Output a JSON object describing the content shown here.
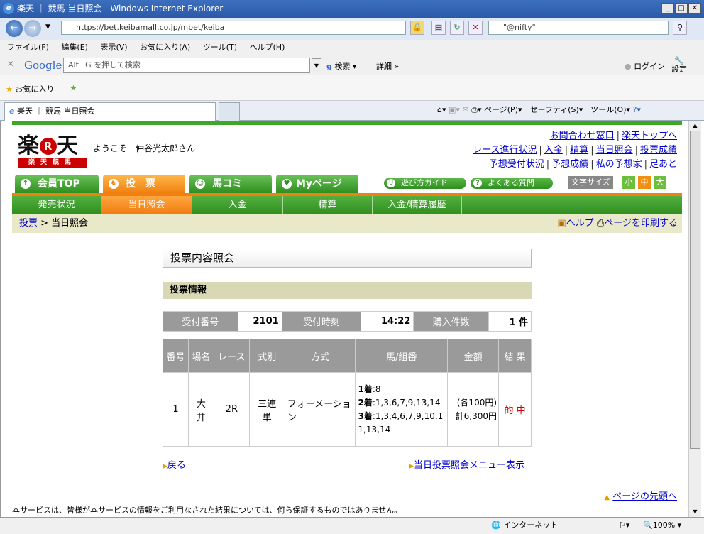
{
  "window": {
    "title": "楽天 ｜ 競馬 当日照会 - Windows Internet Explorer"
  },
  "address": {
    "url": "https://bet.keibamall.co.jp/mbet/keiba",
    "search_value": "\"@nifty\""
  },
  "menu": [
    "ファイル(F)",
    "編集(E)",
    "表示(V)",
    "お気に入り(A)",
    "ツール(T)",
    "ヘルプ(H)"
  ],
  "google": {
    "logo": "Google",
    "placeholder": "Alt+G を押して検索",
    "search_label": "検索",
    "detail_label": "詳細 »",
    "login": "ログイン",
    "settings": "設定"
  },
  "favorites": {
    "label": "お気に入り"
  },
  "tab": {
    "title": "楽天 ｜ 競馬 当日照会"
  },
  "commandbar": "ページ(P)▾　セーフティ(S)▾　ツール(O)▾",
  "site": {
    "logo_main": "楽天",
    "logo_r": "R",
    "logo_sub": "楽天競馬",
    "welcome": "ようこそ　仲谷光太郎さん",
    "links1": [
      "お問合わせ窓口",
      "楽天トップへ"
    ],
    "links2": [
      "レース進行状況",
      "入金",
      "精算",
      "当日照会",
      "投票成績"
    ],
    "links3": [
      "予想受付状況",
      "予想成績",
      "私の予想家",
      "足あと"
    ],
    "tabs": [
      "会員TOP",
      "投　票",
      "馬コミ",
      "Myページ"
    ],
    "guide": "遊び方ガイド",
    "faq": "よくある質問",
    "fontsize_label": "文字サイズ",
    "fs_small": "小",
    "fs_mid": "中",
    "fs_large": "大",
    "subnav": [
      "発売状況",
      "当日照会",
      "入金",
      "精算",
      "入金/精算履歴"
    ],
    "crumb_link": "投票",
    "crumb_current": " > 当日照会",
    "help": "ヘルプ",
    "print": "ページを印刷する"
  },
  "content": {
    "section_title": "投票内容照会",
    "subsection_title": "投票情報",
    "info": {
      "receipt_label": "受付番号",
      "receipt_value": "2101",
      "time_label": "受付時刻",
      "time_value": "14:22",
      "count_label": "購入件数",
      "count_value": "1 件"
    },
    "headers": [
      "番号",
      "場名",
      "レース",
      "式別",
      "方式",
      "馬/組番",
      "金額",
      "結 果"
    ],
    "row": {
      "num": "1",
      "venue": "大井",
      "race": "2R",
      "type": "三連単",
      "method": "フォーメーション",
      "first": "1着",
      "first_val": ":8",
      "second": "2着",
      "second_val": ":1,3,6,7,9,13,14",
      "third": "3着",
      "third_val": ":1,3,4,6,7,9,10,11,13,14",
      "amount_each": "(各100円)",
      "amount_total": "計6,300円",
      "result": "的 中"
    },
    "back": "戻る",
    "menu_link": "当日投票照会メニュー表示",
    "to_top": "ページの先頭へ",
    "disclaimer": "本サービスは、皆様が本サービスの情報をご利用なされた結果については、何ら保証するものではありません。"
  },
  "status": {
    "zone": "インターネット",
    "zoom": "100%"
  }
}
